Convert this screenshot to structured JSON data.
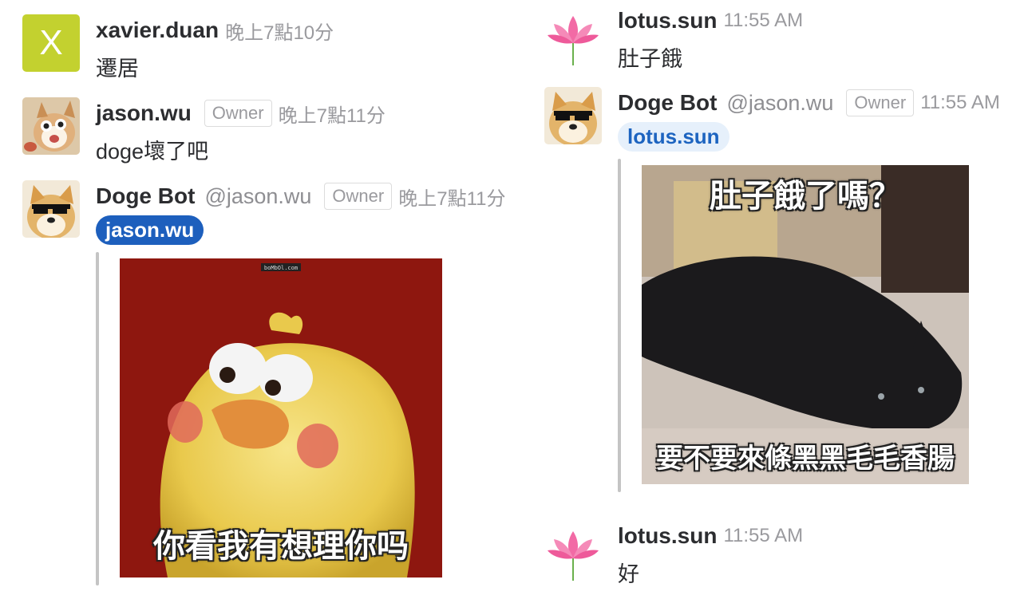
{
  "colors": {
    "mention_dark_bg": "#1d5fbd",
    "mention_light_bg": "#e6f0fb",
    "avatar_x_bg": "#c3d12f"
  },
  "left_column": {
    "msg1": {
      "avatar_letter": "X",
      "username": "xavier.duan",
      "time": "晚上7點10分",
      "text": "遷居"
    },
    "msg2": {
      "avatar": "doge-avatar-icon",
      "username": "jason.wu",
      "badge": "Owner",
      "time": "晚上7點11分",
      "text": "doge壞了吧"
    },
    "msg3": {
      "avatar": "doge-sunglasses-avatar-icon",
      "username": "Doge Bot",
      "handle": "@jason.wu",
      "badge": "Owner",
      "time": "晚上7點11分",
      "mention": "jason.wu",
      "image": {
        "watermark": "boMbOl.com",
        "caption": "你看我有想理你吗"
      }
    }
  },
  "right_column": {
    "msg1": {
      "avatar": "lotus-icon",
      "username": "lotus.sun",
      "time": "11:55 AM",
      "text": "肚子餓"
    },
    "msg2": {
      "avatar": "doge-sunglasses-avatar-icon",
      "username": "Doge Bot",
      "handle": "@jason.wu",
      "badge": "Owner",
      "time": "11:55 AM",
      "mention": "lotus.sun",
      "image": {
        "caption_top": "肚子餓了嗎？",
        "caption_bottom": "要不要來條黑黑毛毛香腸"
      }
    },
    "msg3": {
      "avatar": "lotus-icon",
      "username": "lotus.sun",
      "time": "11:55 AM",
      "text": "好"
    }
  }
}
